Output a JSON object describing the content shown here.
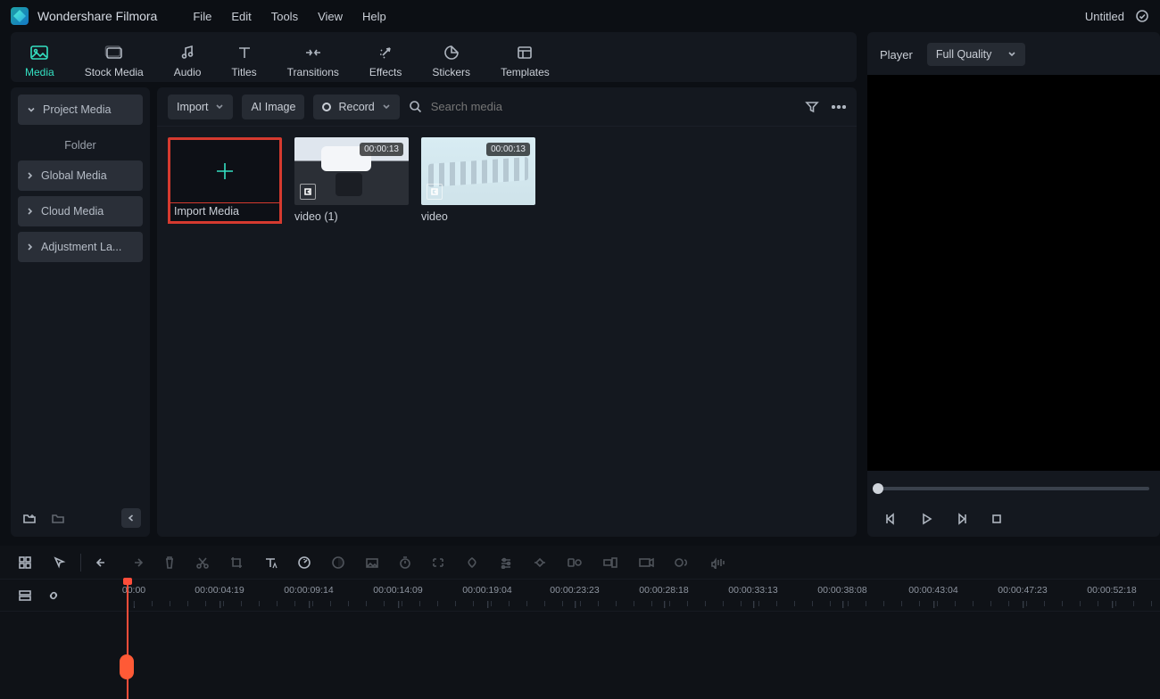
{
  "app": {
    "title": "Wondershare Filmora",
    "doc_title": "Untitled"
  },
  "menu": {
    "file": "File",
    "edit": "Edit",
    "tools": "Tools",
    "view": "View",
    "help": "Help"
  },
  "nav": {
    "media": "Media",
    "stock": "Stock Media",
    "audio": "Audio",
    "titles": "Titles",
    "transitions": "Transitions",
    "effects": "Effects",
    "stickers": "Stickers",
    "templates": "Templates"
  },
  "sidebar": {
    "project": "Project Media",
    "folder": "Folder",
    "global": "Global Media",
    "cloud": "Cloud Media",
    "adjust": "Adjustment La..."
  },
  "toolbar": {
    "import": "Import",
    "ai": "AI Image",
    "record": "Record",
    "search_ph": "Search media"
  },
  "cards": {
    "import": "Import Media",
    "v1_dur": "00:00:13",
    "v1": "video (1)",
    "v2_dur": "00:00:13",
    "v2": "video"
  },
  "player": {
    "label": "Player",
    "quality": "Full Quality"
  },
  "ruler": {
    "t0": "00:00",
    "t1": "00:00:04:19",
    "t2": "00:00:09:14",
    "t3": "00:00:14:09",
    "t4": "00:00:19:04",
    "t5": "00:00:23:23",
    "t6": "00:00:28:18",
    "t7": "00:00:33:13",
    "t8": "00:00:38:08",
    "t9": "00:00:43:04",
    "t10": "00:00:47:23",
    "t11": "00:00:52:18"
  }
}
